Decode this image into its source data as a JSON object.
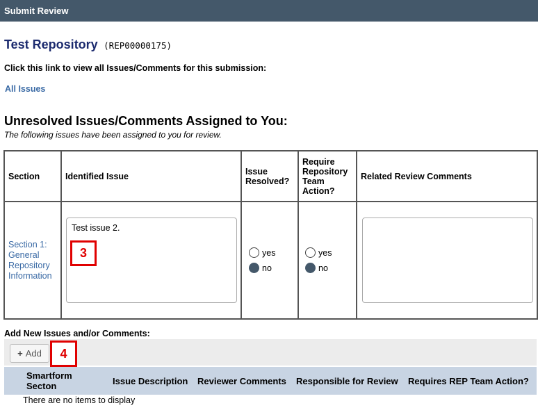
{
  "window": {
    "title": "Submit Review"
  },
  "repository": {
    "name": "Test Repository",
    "id": "(REP00000175)"
  },
  "links_section": {
    "text": "Click this link to view all Issues/Comments for this submission:",
    "all_issues": "All Issues"
  },
  "unresolved": {
    "heading": "Unresolved Issues/Comments Assigned to You:",
    "subheading": "The following issues have been assigned to you for review.",
    "columns": [
      "Section",
      "Identified Issue",
      "Issue Resolved?",
      "Require Repository Team Action?",
      "Related Review Comments"
    ],
    "rows": [
      {
        "section": "Section 1: General Repository Information",
        "issue": "Test issue 2.",
        "resolved": {
          "options": [
            "yes",
            "no"
          ],
          "selected": "no"
        },
        "team_action": {
          "options": [
            "yes",
            "no"
          ],
          "selected": "no"
        },
        "comments": ""
      }
    ]
  },
  "callouts": {
    "issue_marker": "3",
    "add_marker": "4"
  },
  "add_new": {
    "label": "Add New Issues and/or Comments:",
    "add_button": "Add",
    "columns": [
      "Smartform Secton",
      "Issue Description",
      "Reviewer Comments",
      "Responsible for Review",
      "Requires REP Team Action?"
    ],
    "empty_text": "There are no items to display"
  },
  "colors": {
    "titlebar": "#44586a",
    "link": "#3a6aa5",
    "callout": "#e00000",
    "grid_header": "#c8d4e3"
  }
}
